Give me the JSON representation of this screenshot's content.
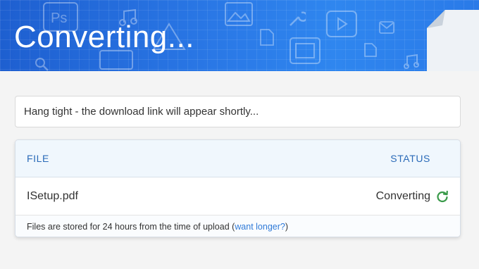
{
  "banner": {
    "title": "Converting...",
    "decor_icons": [
      "ps-icon",
      "music-note-icon",
      "image-icon",
      "pencil-icon",
      "wrench-icon",
      "video-icon",
      "mail-icon",
      "document-icon",
      "film-icon",
      "search-icon",
      "camera-icon"
    ]
  },
  "notice": {
    "text": "Hang tight - the download link will appear shortly..."
  },
  "table": {
    "header_file": "FILE",
    "header_status": "STATUS",
    "rows": [
      {
        "file": "ISetup.pdf",
        "status": "Converting",
        "status_icon": "refresh-icon"
      }
    ],
    "footer_text": "Files are stored for 24 hours from the time of upload (",
    "footer_link": "want longer?",
    "footer_close": ")"
  },
  "colors": {
    "banner_blue": "#2a78e6",
    "header_text_blue": "#2a6ab8",
    "link_blue": "#2f7ad8",
    "spinner_green": "#3a9a4a"
  }
}
